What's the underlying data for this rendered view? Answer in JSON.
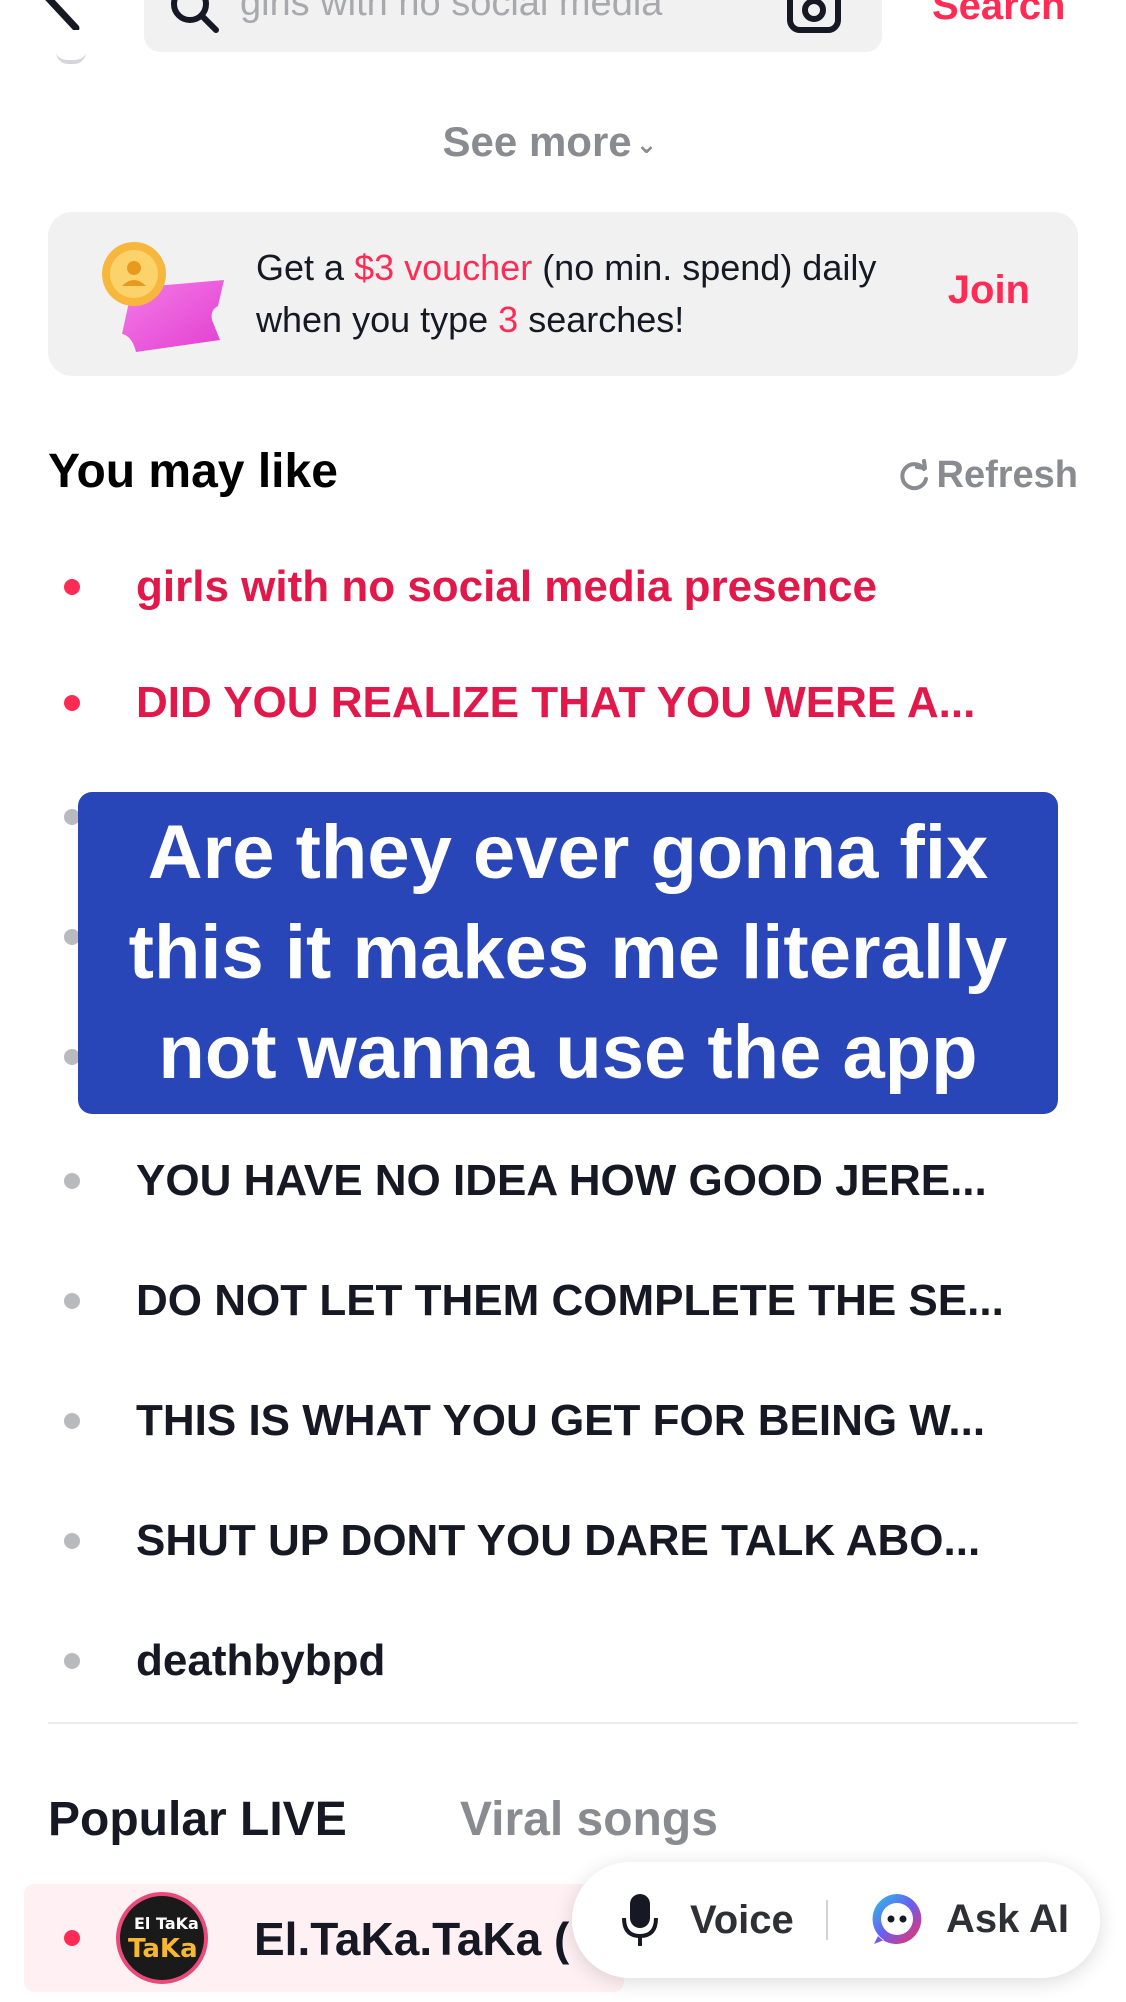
{
  "search": {
    "query": "girls with no social media",
    "button_label": "Search"
  },
  "see_more": {
    "label": "See more",
    "chevron": "⌄"
  },
  "voucher": {
    "text_part1": "Get a ",
    "amount": "$3 voucher",
    "text_part2": " (no min. spend) daily when you type ",
    "count": "3",
    "text_part3": " searches!",
    "join_label": "Join"
  },
  "you_may_like": {
    "title": "You may like",
    "refresh_label": "Refresh",
    "items": [
      {
        "label": "girls with no social media presence",
        "hot": true
      },
      {
        "label": "DID YOU REALIZE THAT YOU WERE A...",
        "hot": true
      },
      {
        "label": "YOU HAVE NO IDEA HOW GOOD JERE...",
        "hot": false
      },
      {
        "label": "DO NOT LET THEM COMPLETE THE SE...",
        "hot": false
      },
      {
        "label": "THIS IS WHAT YOU GET FOR BEING W...",
        "hot": false
      },
      {
        "label": "SHUT UP DONT YOU DARE TALK ABO...",
        "hot": false
      },
      {
        "label": "deathbybpd",
        "hot": false
      }
    ]
  },
  "overlay_caption": "Are they ever gonna fix this it makes me literally not wanna use the app",
  "tabs": {
    "popular_live": "Popular LIVE",
    "viral_songs": "Viral songs"
  },
  "live_card": {
    "avatar_top": "El TaKa",
    "avatar_bottom": "TaKa",
    "name": "El.TaKa.TaKa ("
  },
  "assist": {
    "voice_label": "Voice",
    "ai_label": "Ask AI"
  },
  "colors": {
    "accent": "#fe2c55",
    "overlay": "#2946b8"
  }
}
